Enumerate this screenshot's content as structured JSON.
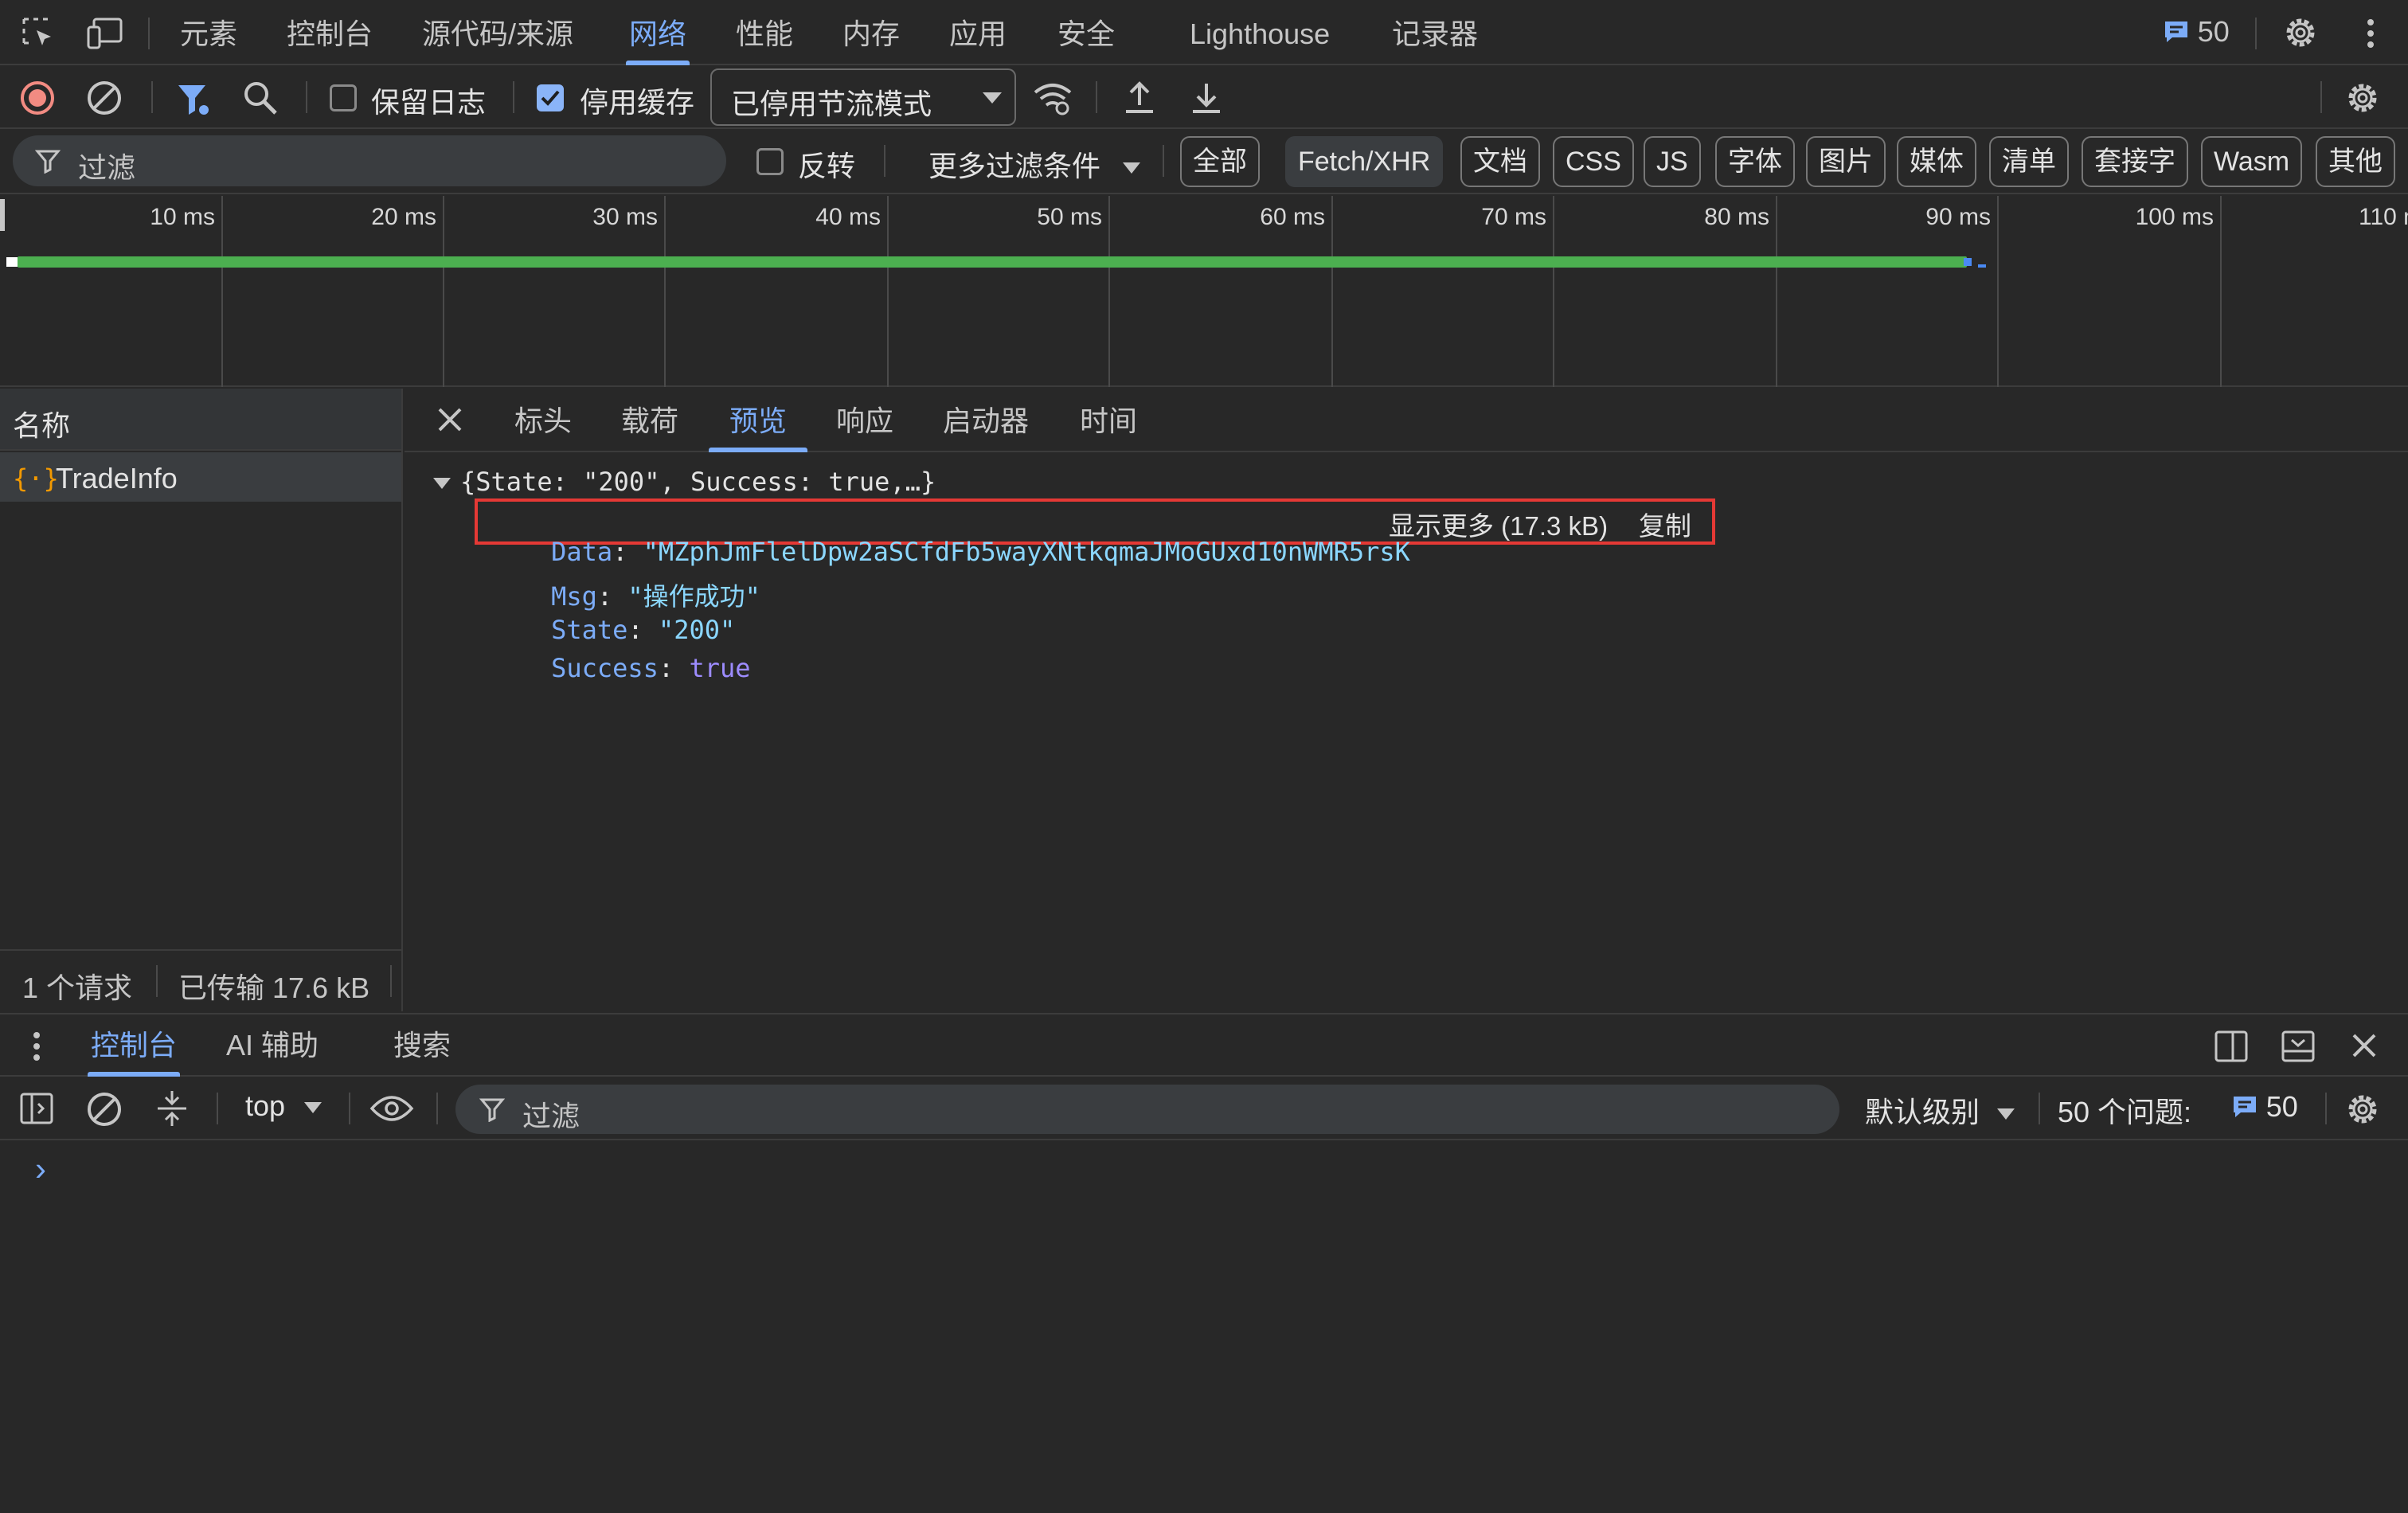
{
  "main_tabs": [
    "元素",
    "控制台",
    "源代码/来源",
    "网络",
    "性能",
    "内存",
    "应用",
    "安全",
    "Lighthouse",
    "记录器"
  ],
  "issues_count": "50",
  "toolbar": {
    "preserve_log": "保留日志",
    "disable_cache": "停用缓存",
    "throttle": "已停用节流模式"
  },
  "filter": {
    "placeholder": "过滤",
    "invert": "反转",
    "more_filters": "更多过滤条件",
    "types": [
      "全部",
      "Fetch/XHR",
      "文档",
      "CSS",
      "JS",
      "字体",
      "图片",
      "媒体",
      "清单",
      "套接字",
      "Wasm",
      "其他"
    ]
  },
  "timeline": {
    "ticks": [
      "10 ms",
      "20 ms",
      "30 ms",
      "40 ms",
      "50 ms",
      "60 ms",
      "70 ms",
      "80 ms",
      "90 ms",
      "100 ms",
      "110 ms"
    ],
    "bar_color": "#4caf50"
  },
  "request_list": {
    "header": "名称",
    "items": [
      "TradeInfo"
    ],
    "summary": {
      "requests": "1 个请求",
      "transferred": "已传输 17.6 kB"
    }
  },
  "detail_tabs": [
    "标头",
    "载荷",
    "预览",
    "响应",
    "启动器",
    "时间"
  ],
  "preview": {
    "summary": "{State: \"200\", Success: true,…}",
    "data_key": "Data",
    "data_value": "\"MZphJmFlelDpw2aSCfdFb5wayXNtkqmaJMoGUxd10nWMR5rsK",
    "show_more": "显示更多 (17.3 kB)",
    "copy": "复制",
    "msg_key": "Msg",
    "msg_value": "\"操作成功\"",
    "state_key": "State",
    "state_value": "\"200\"",
    "success_key": "Success",
    "success_value": "true"
  },
  "drawer": {
    "tabs": [
      "控制台",
      "AI 辅助",
      "搜索"
    ],
    "context": "top",
    "filter_placeholder": "过滤",
    "level": "默认级别",
    "issues_label": "50 个问题:",
    "issues_count": "50",
    "prompt": "›"
  }
}
